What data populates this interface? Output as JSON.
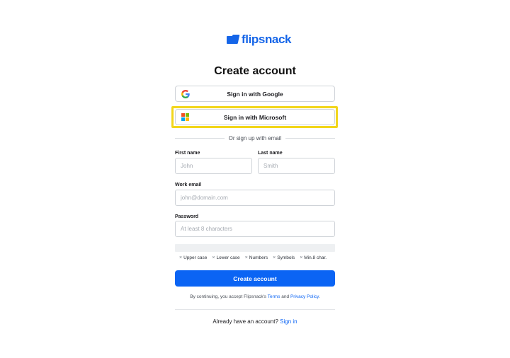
{
  "brand": {
    "name": "flipsnack",
    "color": "#1565e8"
  },
  "page": {
    "title": "Create account"
  },
  "oauth": {
    "google_label": "Sign in with Google",
    "microsoft_label": "Sign in with Microsoft",
    "highlight_color": "#f2d61b"
  },
  "divider": {
    "text": "Or sign up with email"
  },
  "form": {
    "first_name": {
      "label": "First name",
      "placeholder": "John",
      "value": ""
    },
    "last_name": {
      "label": "Last name",
      "placeholder": "Smith",
      "value": ""
    },
    "email": {
      "label": "Work email",
      "placeholder": "john@domain.com",
      "value": ""
    },
    "password": {
      "label": "Password",
      "placeholder": "At least 8 characters",
      "value": ""
    }
  },
  "password_rules": [
    "Upper case",
    "Lower case",
    "Numbers",
    "Symbols",
    "Min.8 char."
  ],
  "submit": {
    "label": "Create account",
    "color": "#0b64f4"
  },
  "legal": {
    "prefix": "By continuing, you accept Flipsnack's",
    "terms": "Terms",
    "and": "and",
    "privacy": "Privacy Policy",
    "suffix": "."
  },
  "signin": {
    "prompt": "Already have an account?",
    "link": "Sign in"
  },
  "icons": {
    "google": "google-icon",
    "microsoft": "microsoft-icon",
    "rule": "x-icon"
  }
}
